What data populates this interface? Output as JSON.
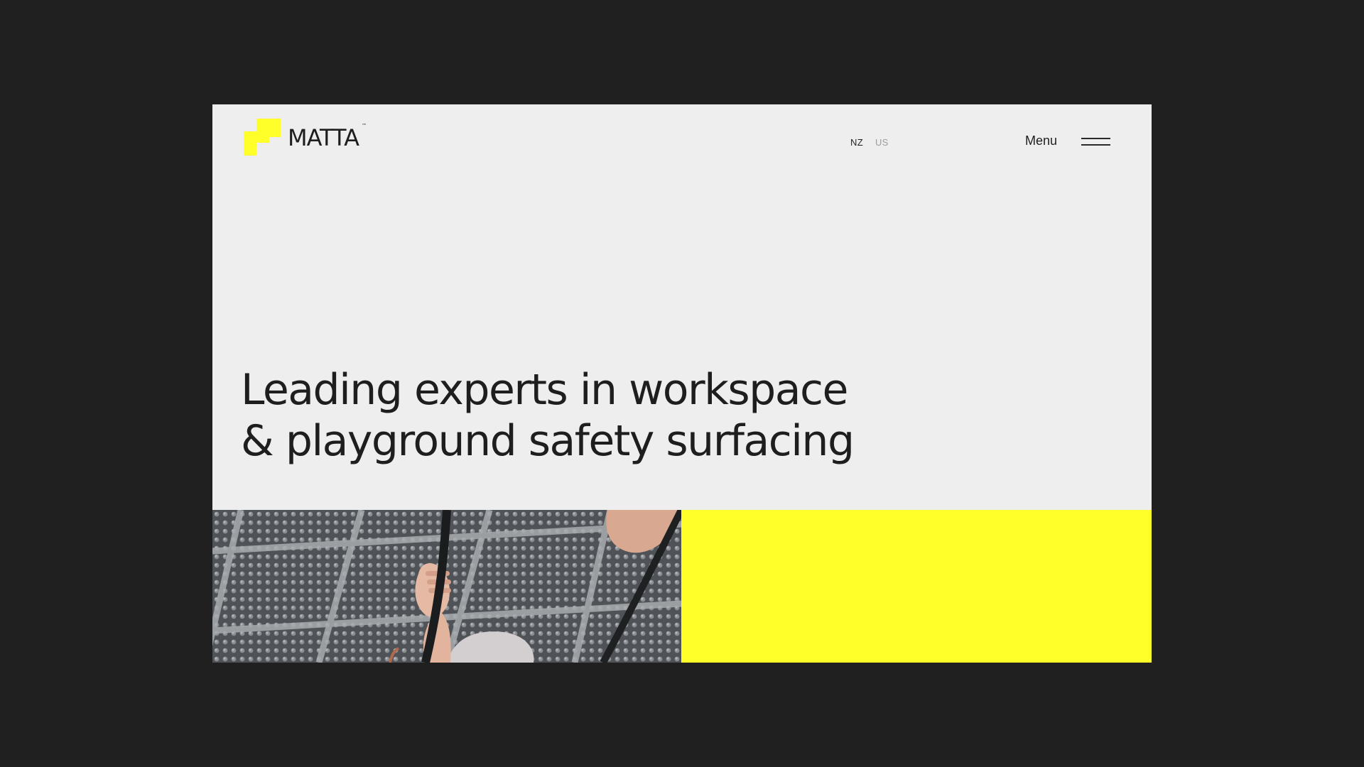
{
  "brand": {
    "name": "MATTA",
    "trademark": "™",
    "accent_color": "#ffff2a",
    "logo_icon": "stepped-square-logo-icon"
  },
  "language": {
    "active": "NZ",
    "inactive": "US"
  },
  "nav": {
    "menu_label": "Menu",
    "menu_icon": "hamburger-icon"
  },
  "hero": {
    "headline_line1": "Leading experts in workspace",
    "headline_line2": "& playground safety surfacing"
  },
  "colors": {
    "page_background": "#202020",
    "panel_background": "#eeeeee",
    "text": "#1e1e1e",
    "muted_text": "#9b9b9b"
  }
}
